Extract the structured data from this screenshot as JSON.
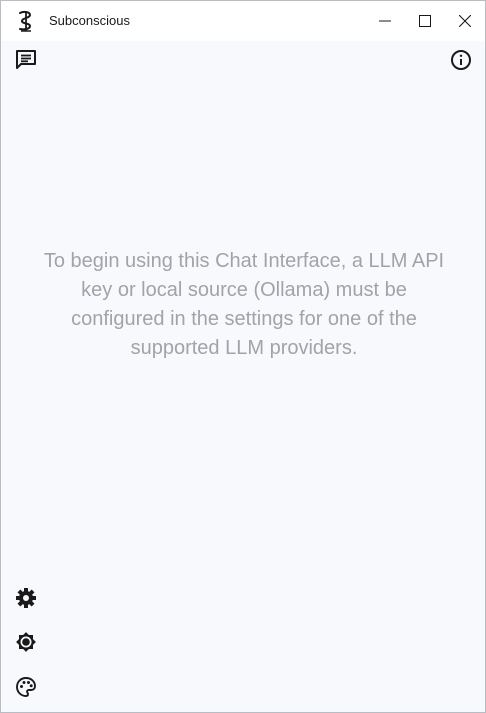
{
  "window": {
    "title": "Subconscious",
    "controls": {
      "minimize": "minimize-icon",
      "maximize": "maximize-icon",
      "close": "close-icon"
    }
  },
  "toolbar": {
    "left_icon": "chat-lines-icon",
    "right_icon": "info-circle-icon"
  },
  "main": {
    "empty_message": "To begin using this Chat Interface, a LLM API key or local source (Ollama) must be configured in the settings for one of the supported LLM providers."
  },
  "sidebar_bottom": {
    "icons": [
      "settings-gear-icon",
      "brightness-icon",
      "palette-icon"
    ]
  },
  "colors": {
    "background": "#f8f9fd",
    "titlebar": "#ffffff",
    "message_text": "#a2a3a8",
    "icon": "#1a1a1a"
  }
}
